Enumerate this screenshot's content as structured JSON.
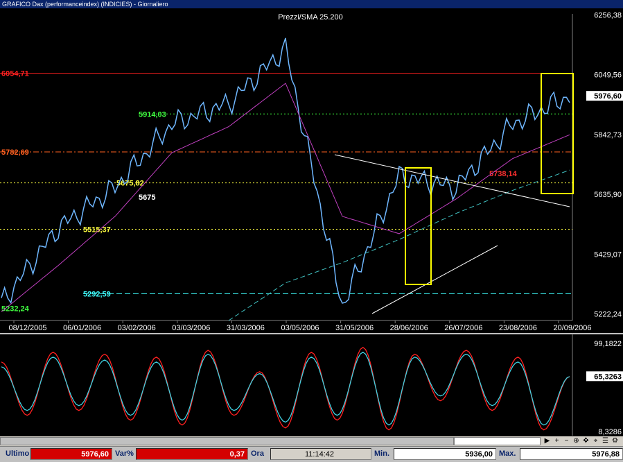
{
  "window": {
    "title": "GRAFICO Dax (performanceindex) (INDICIES) - Giornaliero"
  },
  "price_panel": {
    "title": "Prezzi/SMA 25.200",
    "y_ticks": [
      "6256,38",
      "6049,56",
      "5976,60",
      "5842,73",
      "5635,90",
      "5429,07",
      "5222,24"
    ],
    "x_ticks": [
      "08/12/2005",
      "06/01/2006",
      "03/02/2006",
      "03/03/2006",
      "31/03/2006",
      "03/05/2006",
      "31/05/2006",
      "28/06/2006",
      "26/07/2006",
      "23/08/2006",
      "20/09/2006"
    ],
    "levels": [
      {
        "label": "6054,71",
        "value": 6054.71,
        "color": "#ff2020",
        "style": "solid"
      },
      {
        "label": "5914,03",
        "value": 5914.03,
        "color": "#40ff40",
        "style": "dotted"
      },
      {
        "label": "5782,69",
        "value": 5782.69,
        "color": "#ff6020",
        "style": "dashdot"
      },
      {
        "label": "5675,82",
        "value": 5675.82,
        "color": "#ffff40",
        "style": "dotted"
      },
      {
        "label": "5515,37",
        "value": 5515.37,
        "color": "#ffff40",
        "style": "dotted"
      },
      {
        "label": "5292,59",
        "value": 5292.59,
        "color": "#40ffff",
        "style": "dashed"
      },
      {
        "label": "5232,24",
        "value": 5232.24,
        "color": "#40ff40",
        "style": "none"
      }
    ],
    "annotations": [
      {
        "text": "5675",
        "color": "#ffffff"
      },
      {
        "text": "5738,14",
        "color": "#ff3030"
      }
    ],
    "last_value_label": "5976,60"
  },
  "chart_data": [
    {
      "type": "line",
      "title": "Prezzi/SMA 25.200",
      "xlabel": "",
      "ylabel": "",
      "ylim": [
        5200,
        6260
      ],
      "x": [
        "08/12/2005",
        "06/01/2006",
        "03/02/2006",
        "03/03/2006",
        "31/03/2006",
        "03/05/2006",
        "31/05/2006",
        "28/06/2006",
        "26/07/2006",
        "23/08/2006",
        "20/09/2006"
      ],
      "series": [
        {
          "color": "#6fb7ff",
          "values": [
            5260,
            5520,
            5660,
            5880,
            5950,
            6140,
            5250,
            5700,
            5660,
            5880,
            5976.6
          ]
        },
        {
          "color": "#c040c0",
          "values": [
            5230,
            5390,
            5560,
            5780,
            5870,
            6020,
            5560,
            5500,
            5620,
            5760,
            5842
          ]
        },
        {
          "color": "#40c0c0",
          "values": [
            null,
            null,
            null,
            null,
            5200,
            5330,
            5400,
            5480,
            5570,
            5650,
            5720
          ]
        }
      ],
      "grid": false
    },
    {
      "type": "line",
      "title": "",
      "ylim": [
        8.3286,
        99.1822
      ],
      "y_ticks": [
        "99,1822",
        "65,3263",
        "8,3286"
      ],
      "series": [
        {
          "color": "#ff2020",
          "values": [
            80,
            25,
            90,
            30,
            88,
            20,
            85,
            15,
            92,
            25,
            70,
            12,
            90,
            20,
            95,
            10,
            88,
            40,
            92,
            30,
            85,
            10,
            65
          ]
        },
        {
          "color": "#40d0e0",
          "values": [
            75,
            30,
            85,
            35,
            82,
            25,
            80,
            20,
            88,
            30,
            68,
            18,
            85,
            25,
            90,
            15,
            85,
            45,
            88,
            35,
            80,
            15,
            65
          ]
        }
      ],
      "last_value_label": "65,3263"
    }
  ],
  "status": {
    "ultimo_label": "Ultimo",
    "ultimo_value": "5976,60",
    "var_label": "Var%",
    "var_value": "0,37",
    "ora_label": "Ora",
    "ora_value": "11:14:42",
    "min_label": "Min.",
    "min_value": "5936,00",
    "max_label": "Max.",
    "max_value": "5976,88"
  }
}
